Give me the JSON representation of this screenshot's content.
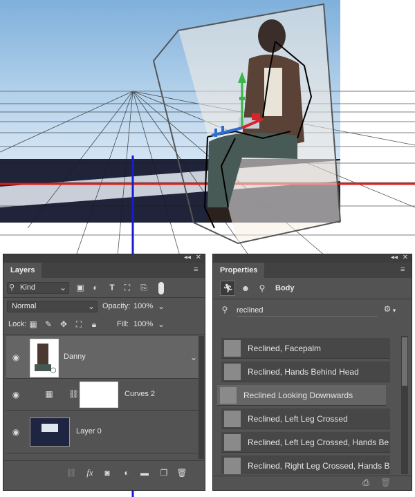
{
  "layers_panel": {
    "tab": "Layers",
    "kind_label": "Kind",
    "blend_mode": "Normal",
    "opacity_label": "Opacity:",
    "opacity_value": "100%",
    "lock_label": "Lock:",
    "fill_label": "Fill:",
    "fill_value": "100%",
    "layers": [
      {
        "name": "Danny"
      },
      {
        "name": "Curves 2"
      },
      {
        "name": "Layer 0"
      }
    ],
    "footer_icons": [
      "link-icon",
      "fx-icon",
      "mask-icon",
      "adjustment-icon",
      "group-folder-icon",
      "new-layer-icon",
      "trash-icon"
    ]
  },
  "properties_panel": {
    "tab": "Properties",
    "section_label": "Body",
    "search_value": "reclined",
    "presets": [
      {
        "label": "Reclined, Facepalm"
      },
      {
        "label": "Reclined, Hands Behind Head"
      },
      {
        "label": "Reclined Looking Downwards"
      },
      {
        "label": "Reclined, Left Leg Crossed"
      },
      {
        "label": "Reclined, Left Leg Crossed, Hands Be"
      },
      {
        "label": "Reclined, Right Leg Crossed, Hands B"
      }
    ],
    "selected_preset": 2
  },
  "colors": {
    "panel_bg": "#535353",
    "guide_blue": "#1a1ad6",
    "guide_red": "#e01b1b"
  }
}
